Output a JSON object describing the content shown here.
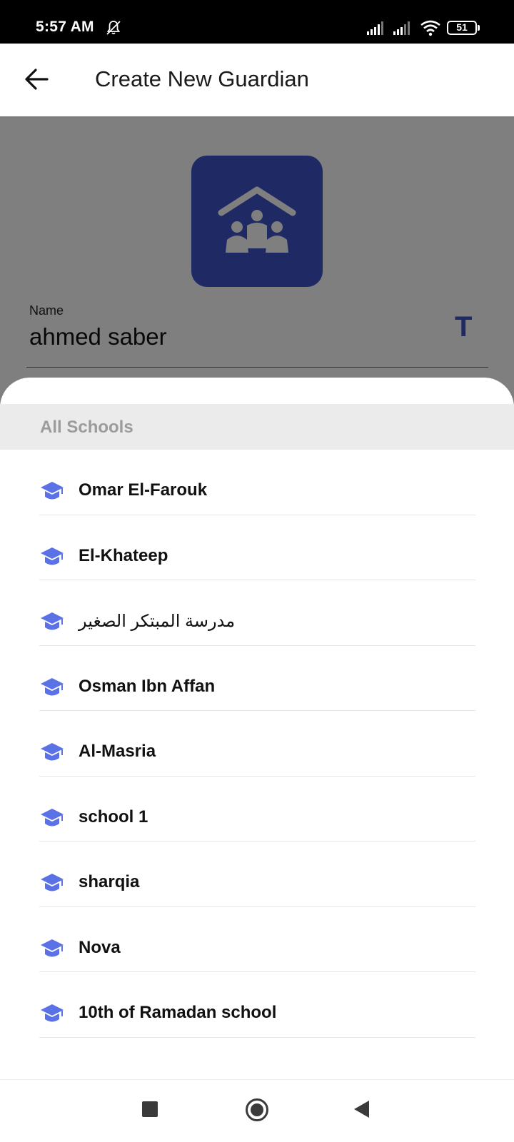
{
  "status_bar": {
    "time": "5:57 AM",
    "battery_level": "51",
    "icons": [
      "mute-icon",
      "signal-icon",
      "signal-icon",
      "wifi-icon",
      "battery-icon"
    ]
  },
  "app_bar": {
    "title": "Create New Guardian",
    "back_icon": "arrow-left-icon"
  },
  "form": {
    "logo_icon": "family-home-icon",
    "name_label": "Name",
    "name_value": "ahmed saber",
    "name_type_icon": "T"
  },
  "sheet": {
    "header": "All Schools",
    "item_icon": "graduation-cap-icon",
    "accent_color": "#5b72e6",
    "schools": [
      {
        "label": "Omar El-Farouk"
      },
      {
        "label": "El-Khateep"
      },
      {
        "label": "مدرسة المبتكر الصغير"
      },
      {
        "label": "Osman Ibn Affan"
      },
      {
        "label": "Al-Masria"
      },
      {
        "label": "school 1"
      },
      {
        "label": "sharqia"
      },
      {
        "label": "Nova"
      },
      {
        "label": "10th of Ramadan school"
      }
    ]
  },
  "nav_bar": {
    "icons": [
      "recents-icon",
      "home-icon",
      "back-icon"
    ]
  }
}
